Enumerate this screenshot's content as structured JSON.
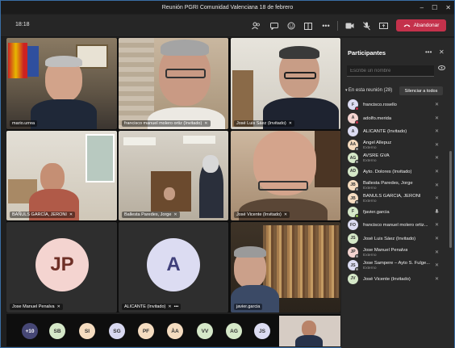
{
  "window": {
    "title": "Reunión PGRI Comunidad Valenciana 18 de febrero",
    "controls": [
      "–",
      "☐",
      "✕"
    ]
  },
  "toolbar": {
    "clock": "18:18",
    "leave_label": "Abandonar",
    "more": "•••"
  },
  "tiles": [
    {
      "name": "mario.urrea",
      "mic_off": false
    },
    {
      "name": "francisco manuel molero ortiz (Invitado)",
      "mic_off": true
    },
    {
      "name": "José Luis Sáez (Invitado)",
      "mic_off": true
    },
    {
      "name": "BAÑULS GARCÍA, JERONI",
      "mic_off": true
    },
    {
      "name": "Ballesta Paredes, Jorge",
      "mic_off": true
    },
    {
      "name": "José Vicente (Invitado)",
      "mic_off": true
    },
    {
      "name": "Jose Manuel Penalva",
      "mic_off": true,
      "initials": "JP",
      "color": "#f4d4d0"
    },
    {
      "name": "ALICANTE (Invitado)",
      "mic_off": true,
      "initials": "A",
      "color": "#dcdcf2",
      "more": "•••"
    },
    {
      "name": "javier.garcia",
      "mic_off": false
    }
  ],
  "strip": {
    "overflow": "+10",
    "avatars": [
      {
        "initials": "SB",
        "color": "#d5e8c8"
      },
      {
        "initials": "SI",
        "color": "#f5dcc0"
      },
      {
        "initials": "SG",
        "color": "#d8d8f0"
      },
      {
        "initials": "PF",
        "color": "#f5dcc0"
      },
      {
        "initials": "ÀA",
        "color": "#f5dcc0"
      },
      {
        "initials": "VV",
        "color": "#d5e8c8"
      },
      {
        "initials": "AG",
        "color": "#d5e8c8"
      },
      {
        "initials": "JS",
        "color": "#dcdcf2"
      }
    ]
  },
  "participants_panel": {
    "title": "Participantes",
    "search_placeholder": "Escribe un nombre",
    "section_label": "En esta reunión (28)",
    "mute_all_label": "Silenciar a todos",
    "list": [
      {
        "initials": "F",
        "name": "francisco.rosello",
        "sub": "",
        "color": "#dcdcf2",
        "dot": "#c4314b",
        "mic": "✕"
      },
      {
        "initials": "A",
        "name": "adolfo.merida",
        "sub": "",
        "color": "#f4d4d0",
        "dot": "#c4314b",
        "mic": "✕"
      },
      {
        "initials": "A",
        "name": "ALICANTE (Invitado)",
        "sub": "",
        "color": "#dcdcf2",
        "dot": "",
        "mic": "✕"
      },
      {
        "initials": "ÀA",
        "name": "Ángel Allepuz",
        "sub": "Externo",
        "color": "#f5dcc0",
        "dot": "#999",
        "mic": "✕"
      },
      {
        "initials": "AG",
        "name": "AVSRE GVA",
        "sub": "Externo",
        "color": "#d5e8c8",
        "dot": "#999",
        "mic": "✕"
      },
      {
        "initials": "AD",
        "name": "Ayto. Dolores (Invitado)",
        "sub": "",
        "color": "#d5e8c8",
        "dot": "",
        "mic": "✕"
      },
      {
        "initials": "JB",
        "name": "Ballesta Paredes, Jorge",
        "sub": "Externo",
        "color": "#f5dcc0",
        "dot": "#999",
        "mic": "✕"
      },
      {
        "initials": "JB",
        "name": "BAÑULS GARCÍA, JERONI",
        "sub": "Externo",
        "color": "#f5dcc0",
        "dot": "#999",
        "mic": "✕"
      },
      {
        "initials": "F",
        "name": "fjavier.garcia",
        "sub": "",
        "color": "#d5e8c8",
        "dot": "#92c353",
        "mic": "🎤"
      },
      {
        "initials": "FO",
        "name": "francisco manuel molero ortiz...",
        "sub": "",
        "color": "#dcdcf2",
        "dot": "",
        "mic": "✕"
      },
      {
        "initials": "JS",
        "name": "José Luis Sáez (Invitado)",
        "sub": "",
        "color": "#d5e8c8",
        "dot": "",
        "mic": "✕"
      },
      {
        "initials": "JP",
        "name": "Jose Manuel Penalva",
        "sub": "Externo",
        "color": "#f4d4d0",
        "dot": "#999",
        "mic": "✕"
      },
      {
        "initials": "JS",
        "name": "Jose Sampere – Ayto S. Fulge...",
        "sub": "Externo",
        "color": "#dcdcf2",
        "dot": "#999",
        "mic": "✕"
      },
      {
        "initials": "JV",
        "name": "José Vicente (Invitado)",
        "sub": "",
        "color": "#d5e8c8",
        "dot": "",
        "mic": "✕"
      }
    ]
  }
}
